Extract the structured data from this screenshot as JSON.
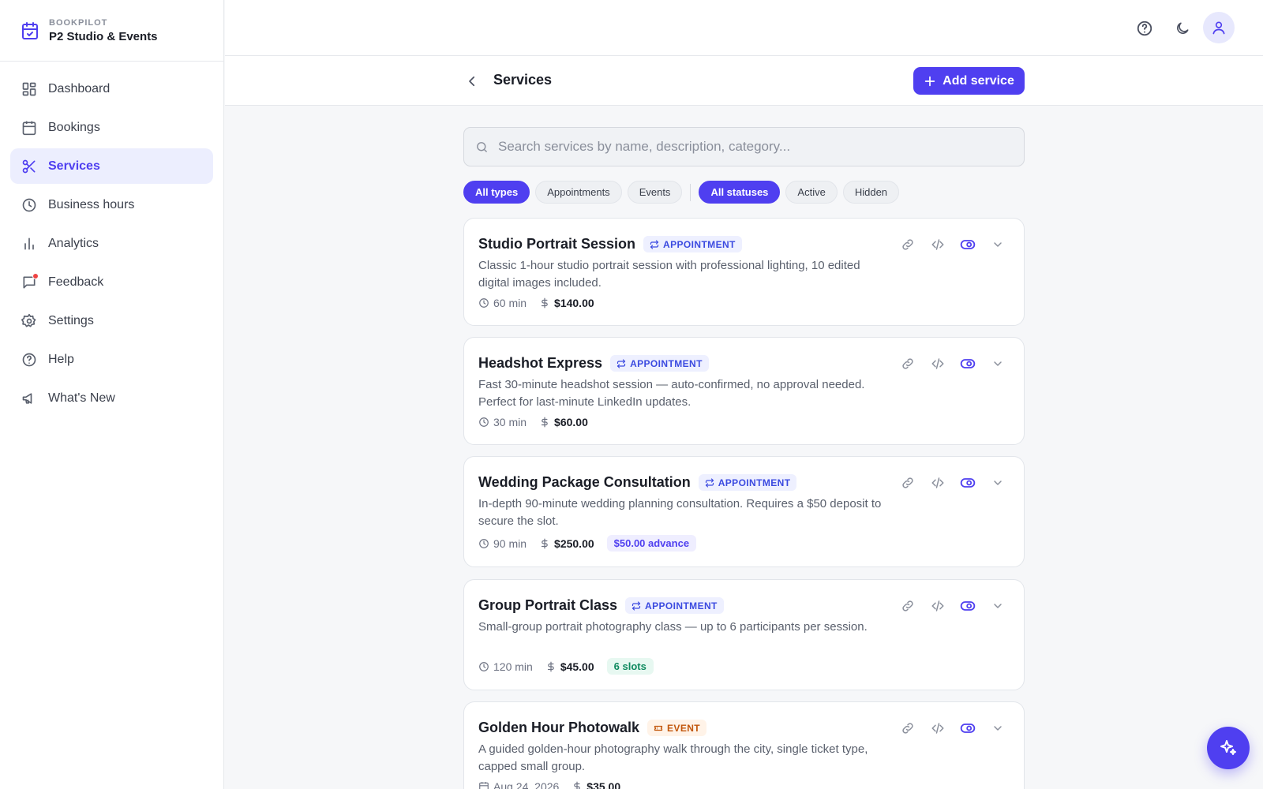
{
  "brand": {
    "kicker": "BOOKPILOT",
    "name": "P2 Studio & Events"
  },
  "sidebar": {
    "items": [
      {
        "label": "Dashboard",
        "icon": "dashboard-icon"
      },
      {
        "label": "Bookings",
        "icon": "calendar-icon"
      },
      {
        "label": "Services",
        "icon": "scissors-icon",
        "active": true
      },
      {
        "label": "Business hours",
        "icon": "clock-icon"
      },
      {
        "label": "Analytics",
        "icon": "bar-chart-icon"
      },
      {
        "label": "Feedback",
        "icon": "message-icon",
        "notification": true
      },
      {
        "label": "Settings",
        "icon": "gear-icon"
      },
      {
        "label": "Help",
        "icon": "help-circle-icon"
      },
      {
        "label": "What's New",
        "icon": "megaphone-icon"
      }
    ]
  },
  "topbar": {
    "icons": [
      "help-icon",
      "moon-icon",
      "user-icon"
    ]
  },
  "header": {
    "title": "Services",
    "add_label": "Add service"
  },
  "search": {
    "placeholder": "Search services by name, description, category..."
  },
  "filters": {
    "type": [
      {
        "label": "All types",
        "selected": true
      },
      {
        "label": "Appointments",
        "selected": false
      },
      {
        "label": "Events",
        "selected": false
      }
    ],
    "status": [
      {
        "label": "All statuses",
        "selected": true
      },
      {
        "label": "Active",
        "selected": false
      },
      {
        "label": "Hidden",
        "selected": false
      }
    ]
  },
  "services": [
    {
      "title": "Studio Portrait Session",
      "badge": "APPOINTMENT",
      "description": "Classic 1-hour studio portrait session with professional lighting, 10 edited digital images included.",
      "duration": "60 min",
      "price": "$140.00"
    },
    {
      "title": "Headshot Express",
      "badge": "APPOINTMENT",
      "description": "Fast 30-minute headshot session — auto-confirmed, no approval needed. Perfect for last-minute LinkedIn updates.",
      "duration": "30 min",
      "price": "$60.00"
    },
    {
      "title": "Wedding Package Consultation",
      "badge": "APPOINTMENT",
      "description": "In-depth 90-minute wedding planning consultation. Requires a $50 deposit to secure the slot.",
      "duration": "90 min",
      "price": "$250.00",
      "extra": "$50.00 advance"
    },
    {
      "title": "Group Portrait Class",
      "badge": "APPOINTMENT",
      "description": "Small-group portrait photography class — up to 6 participants per session.",
      "duration": "120 min",
      "price": "$45.00",
      "extra": "6 slots"
    },
    {
      "title": "Golden Hour Photowalk",
      "badge": "EVENT",
      "description": "A guided golden-hour photography walk through the city, single ticket type, capped small group.",
      "date": "Aug 24, 2026",
      "price": "$35.00"
    }
  ],
  "colors": {
    "accent": "#4f3ff0",
    "badge_appointment": "#3b4ae0",
    "badge_event": "#c2570c",
    "slots": "#0f8a5f",
    "notification": "#ef4444"
  }
}
